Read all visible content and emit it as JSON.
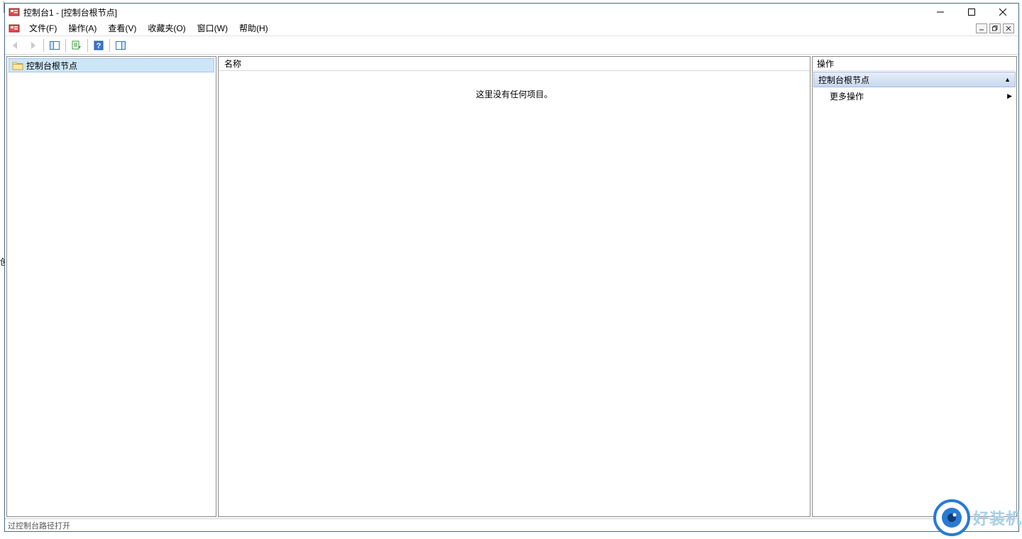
{
  "window": {
    "title": "控制台1 - [控制台根节点]"
  },
  "menu": {
    "file": "文件(F)",
    "action": "操作(A)",
    "view": "查看(V)",
    "favorites": "收藏夹(O)",
    "window": "窗口(W)",
    "help": "帮助(H)"
  },
  "tree": {
    "root": "控制台根节点"
  },
  "center": {
    "column_name": "名称",
    "empty": "这里没有任何项目。"
  },
  "actions": {
    "header": "操作",
    "node_title": "控制台根节点",
    "more": "更多操作"
  },
  "status": "过控制台路径打开",
  "watermark": "好装机"
}
